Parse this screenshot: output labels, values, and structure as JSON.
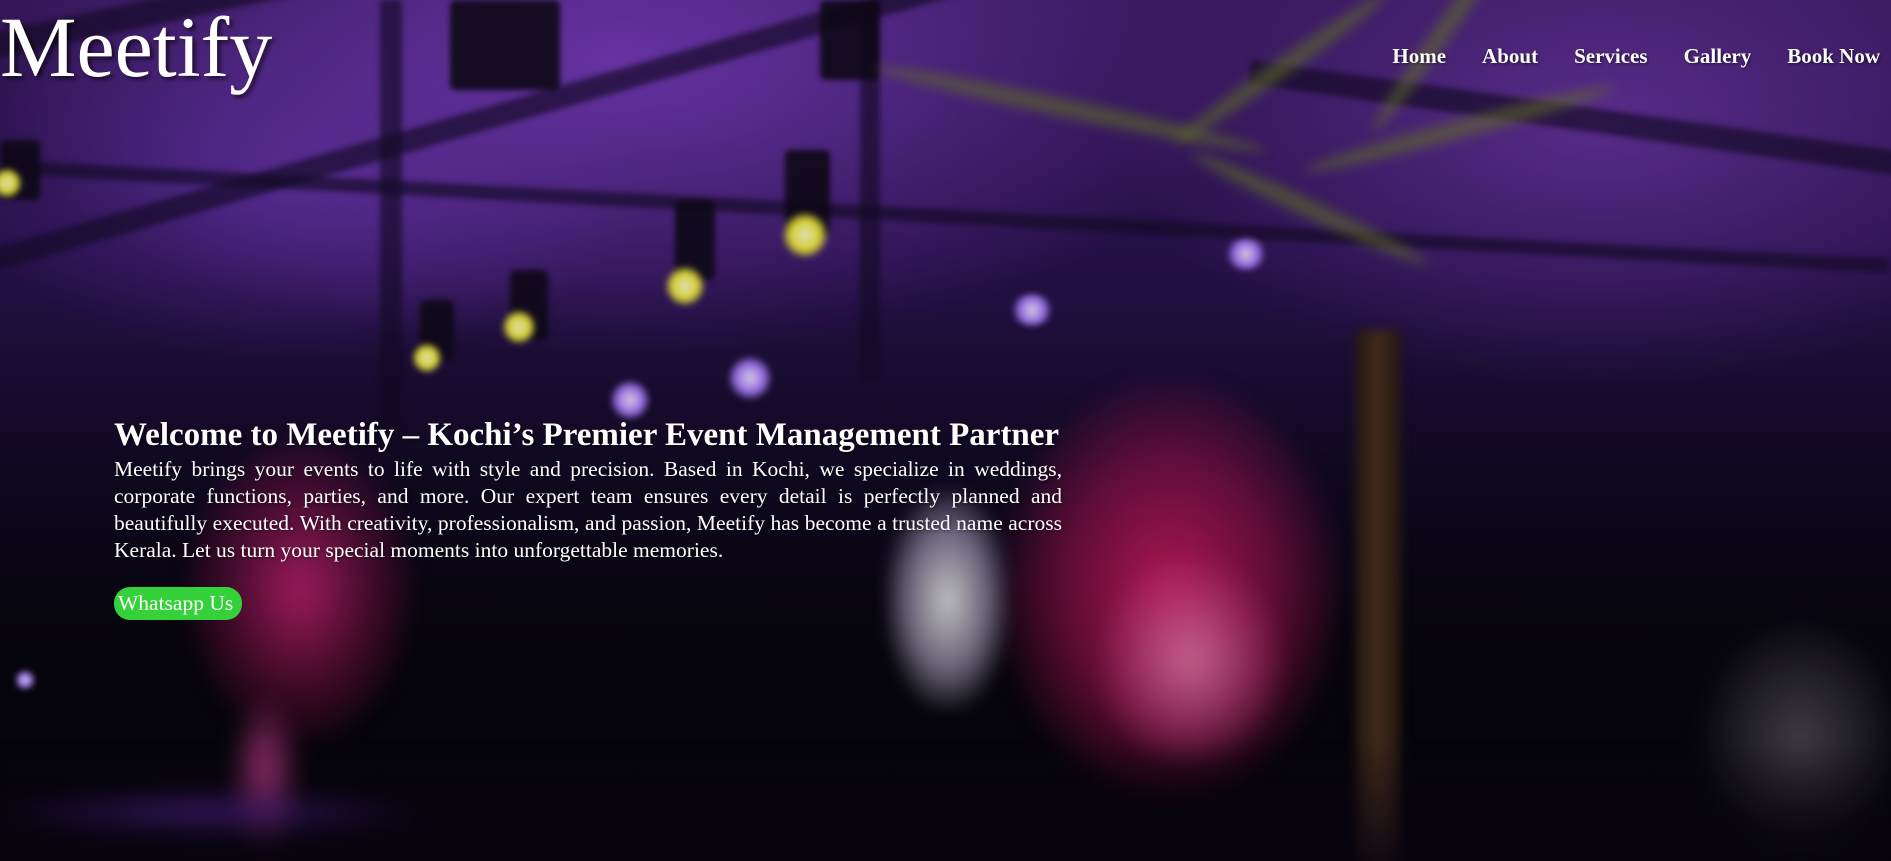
{
  "header": {
    "logo": "Meetify",
    "nav": [
      {
        "label": "Home"
      },
      {
        "label": "About"
      },
      {
        "label": "Services"
      },
      {
        "label": "Gallery"
      },
      {
        "label": "Book Now"
      }
    ]
  },
  "hero": {
    "heading": "Welcome to Meetify – Kochi’s Premier Event Management Partner",
    "description": "Meetify brings your events to life with style and precision. Based in Kochi, we specialize in weddings, corporate functions, parties, and more. Our expert team ensures every detail is perfectly planned and beautifully executed. With creativity, professionalism, and passion, Meetify has become a trusted name across Kerala. Let us turn your special moments into unforgettable memories.",
    "cta_label": "Whatsapp Us"
  },
  "colors": {
    "cta_background": "#35d13a",
    "text": "#ffffff",
    "ambient_purple": "#3a1a62"
  }
}
